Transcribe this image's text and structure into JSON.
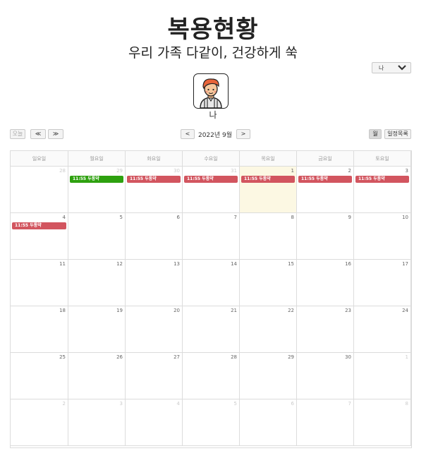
{
  "header": {
    "title": "복용현황",
    "subtitle": "우리 가족 다같이, 건강하게 쑥"
  },
  "member_select": {
    "value": "나"
  },
  "avatar": {
    "name": "나"
  },
  "toolbar": {
    "today_label": "오늘",
    "prev_label": "≪",
    "next_label": "≫",
    "month_prev": "<",
    "month_label": "2022년 9월",
    "month_next": ">",
    "view_month": "월",
    "view_list": "일정목록"
  },
  "calendar": {
    "weekdays": [
      "일요일",
      "월요일",
      "화요일",
      "수요일",
      "목요일",
      "금요일",
      "토요일"
    ],
    "weeks": [
      [
        {
          "n": "28",
          "o": true
        },
        {
          "n": "29",
          "o": true
        },
        {
          "n": "30",
          "o": true
        },
        {
          "n": "31",
          "o": true
        },
        {
          "n": "1",
          "o": false,
          "today": true
        },
        {
          "n": "2",
          "o": false
        },
        {
          "n": "3",
          "o": false
        }
      ],
      [
        {
          "n": "4",
          "o": false
        },
        {
          "n": "5",
          "o": false
        },
        {
          "n": "6",
          "o": false
        },
        {
          "n": "7",
          "o": false
        },
        {
          "n": "8",
          "o": false
        },
        {
          "n": "9",
          "o": false
        },
        {
          "n": "10",
          "o": false
        }
      ],
      [
        {
          "n": "11",
          "o": false
        },
        {
          "n": "12",
          "o": false
        },
        {
          "n": "13",
          "o": false
        },
        {
          "n": "14",
          "o": false
        },
        {
          "n": "15",
          "o": false
        },
        {
          "n": "16",
          "o": false
        },
        {
          "n": "17",
          "o": false
        }
      ],
      [
        {
          "n": "18",
          "o": false
        },
        {
          "n": "19",
          "o": false
        },
        {
          "n": "20",
          "o": false
        },
        {
          "n": "21",
          "o": false
        },
        {
          "n": "22",
          "o": false
        },
        {
          "n": "23",
          "o": false
        },
        {
          "n": "24",
          "o": false
        }
      ],
      [
        {
          "n": "25",
          "o": false
        },
        {
          "n": "26",
          "o": false
        },
        {
          "n": "27",
          "o": false
        },
        {
          "n": "28",
          "o": false
        },
        {
          "n": "29",
          "o": false
        },
        {
          "n": "30",
          "o": false
        },
        {
          "n": "1",
          "o": true
        }
      ],
      [
        {
          "n": "2",
          "o": true
        },
        {
          "n": "3",
          "o": true
        },
        {
          "n": "4",
          "o": true
        },
        {
          "n": "5",
          "o": true
        },
        {
          "n": "6",
          "o": true
        },
        {
          "n": "7",
          "o": true
        },
        {
          "n": "8",
          "o": true
        }
      ]
    ],
    "events": [
      {
        "week": 0,
        "day": 1,
        "label": "11:55 두통약",
        "color": "#2ea10f"
      },
      {
        "week": 0,
        "day": 2,
        "label": "11:55 두통약",
        "color": "#d2555f"
      },
      {
        "week": 0,
        "day": 3,
        "label": "11:55 두통약",
        "color": "#d2555f"
      },
      {
        "week": 0,
        "day": 4,
        "label": "11:55 두통약",
        "color": "#d2555f"
      },
      {
        "week": 0,
        "day": 5,
        "label": "11:55 두통약",
        "color": "#d2555f"
      },
      {
        "week": 0,
        "day": 6,
        "label": "11:55 두통약",
        "color": "#d2555f"
      },
      {
        "week": 1,
        "day": 0,
        "label": "11:55 두통약",
        "color": "#d2555f"
      }
    ]
  }
}
